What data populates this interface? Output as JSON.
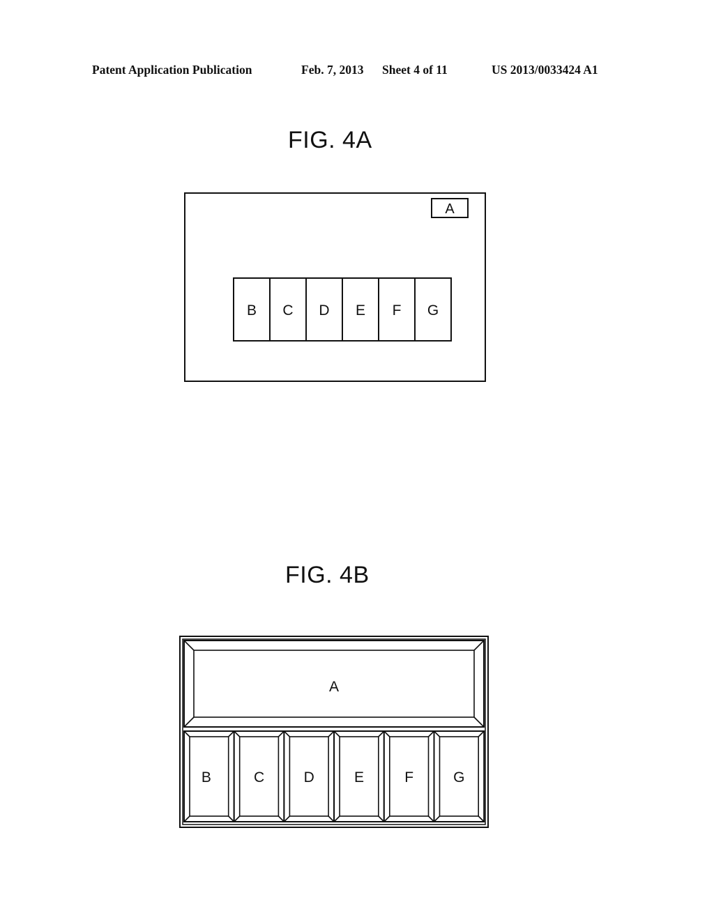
{
  "header": {
    "publication": "Patent Application Publication",
    "date": "Feb. 7, 2013",
    "sheet": "Sheet 4 of 11",
    "number": "US 2013/0033424 A1"
  },
  "figures": [
    {
      "title": "FIG. 4A",
      "screen": {
        "corner_label": "A",
        "buttons": [
          "B",
          "C",
          "D",
          "E",
          "F",
          "G"
        ]
      }
    },
    {
      "title": "FIG. 4B",
      "screen": {
        "top_panel_label": "A",
        "buttons": [
          "B",
          "C",
          "D",
          "E",
          "F",
          "G"
        ]
      }
    }
  ]
}
